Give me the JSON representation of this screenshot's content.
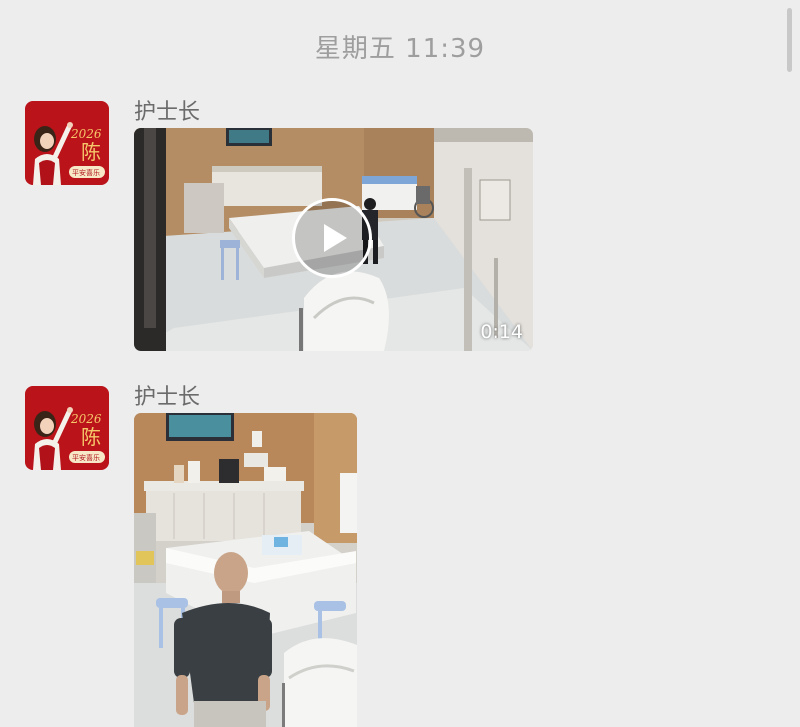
{
  "chat": {
    "timestamp": "星期五 11:39",
    "messages": [
      {
        "sender": "护士长",
        "avatar": {
          "year": "2026",
          "surname": "陈",
          "motto": "平安喜乐"
        },
        "type": "video",
        "duration": "0:14"
      },
      {
        "sender": "护士长",
        "avatar": {
          "year": "2026",
          "surname": "陈",
          "motto": "平安喜乐"
        },
        "type": "image"
      }
    ]
  },
  "colors": {
    "background": "#ededed",
    "avatar_red": "#c8161d",
    "timestamp_text": "#9e9e9e",
    "sender_text": "#6b6b6b"
  },
  "icons": {
    "play": "play-icon"
  }
}
